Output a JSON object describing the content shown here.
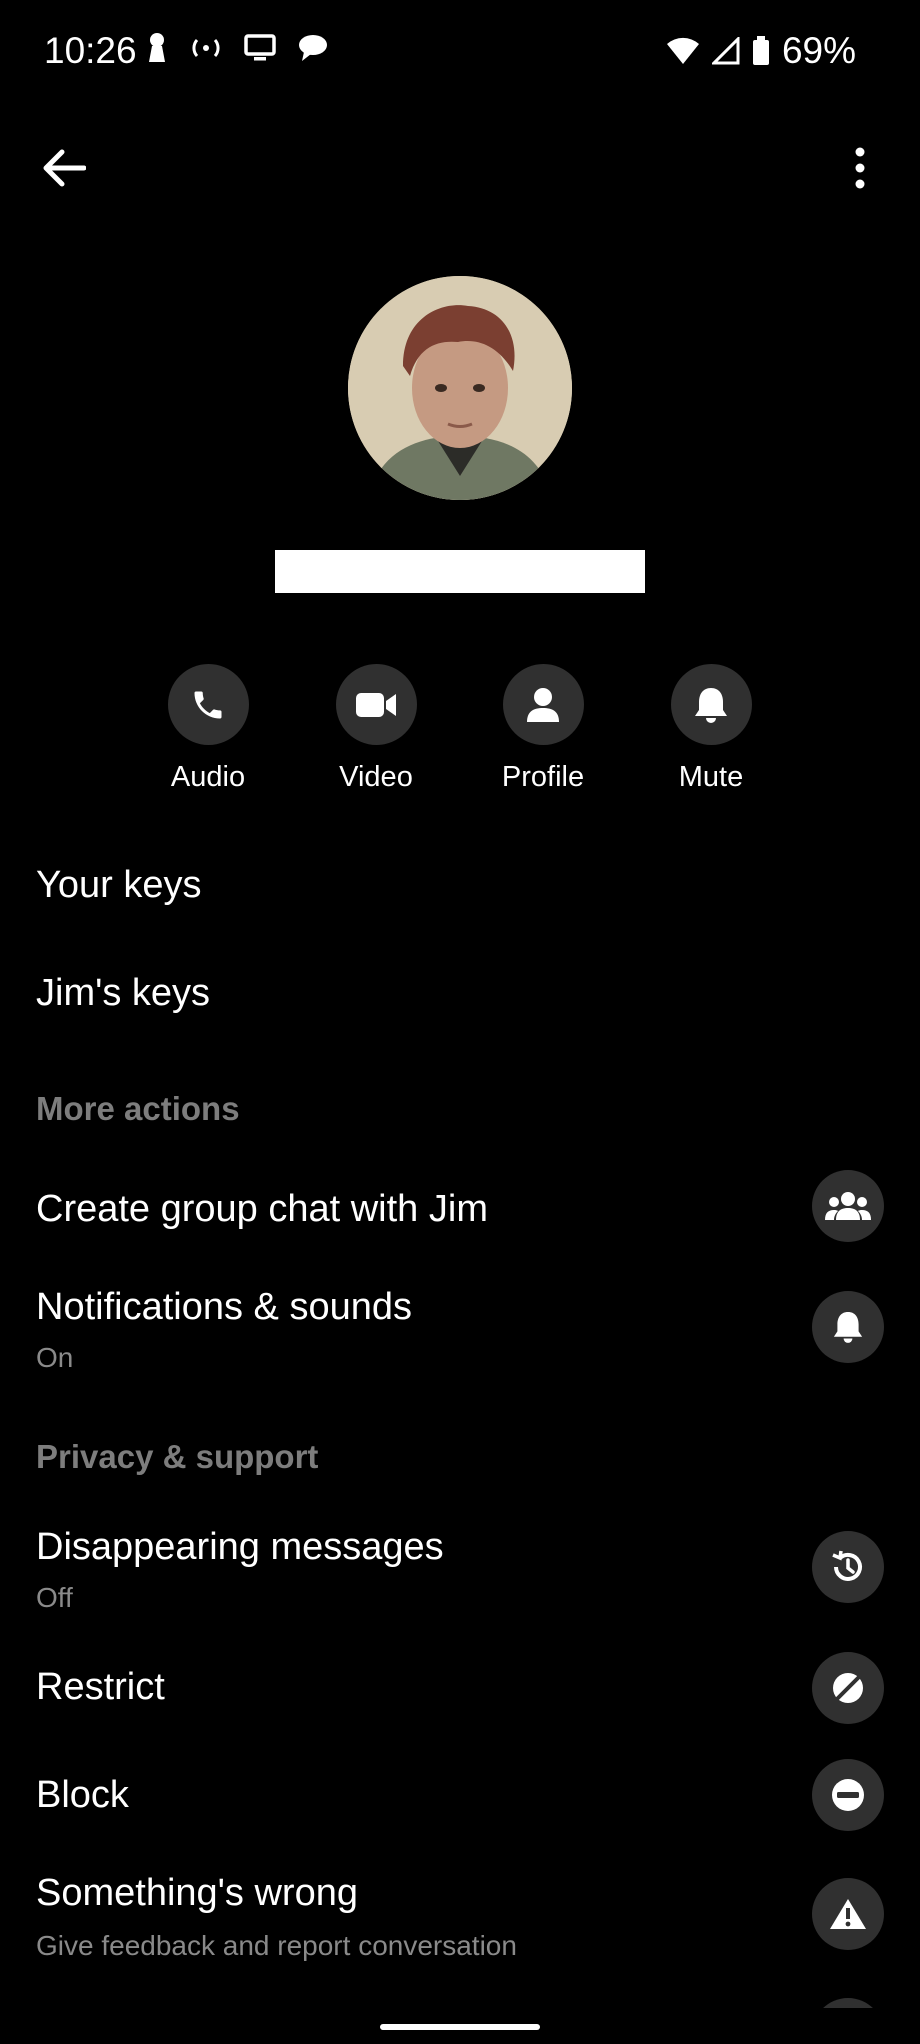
{
  "status_bar": {
    "time": "10:26",
    "battery": "69%"
  },
  "quick_actions": [
    {
      "label": "Audio",
      "icon": "phone-icon"
    },
    {
      "label": "Video",
      "icon": "video-camera-icon"
    },
    {
      "label": "Profile",
      "icon": "person-icon"
    },
    {
      "label": "Mute",
      "icon": "bell-icon"
    }
  ],
  "keys": {
    "your_keys": "Your keys",
    "their_keys": "Jim's keys"
  },
  "more_actions": {
    "header": "More actions",
    "create_group": "Create group chat with Jim",
    "notifications": "Notifications & sounds",
    "notifications_state": "On"
  },
  "privacy": {
    "header": "Privacy & support",
    "disappearing": "Disappearing messages",
    "disappearing_state": "Off",
    "restrict": "Restrict",
    "block": "Block",
    "something_wrong": "Something's wrong",
    "something_wrong_sub": "Give feedback and report conversation"
  }
}
